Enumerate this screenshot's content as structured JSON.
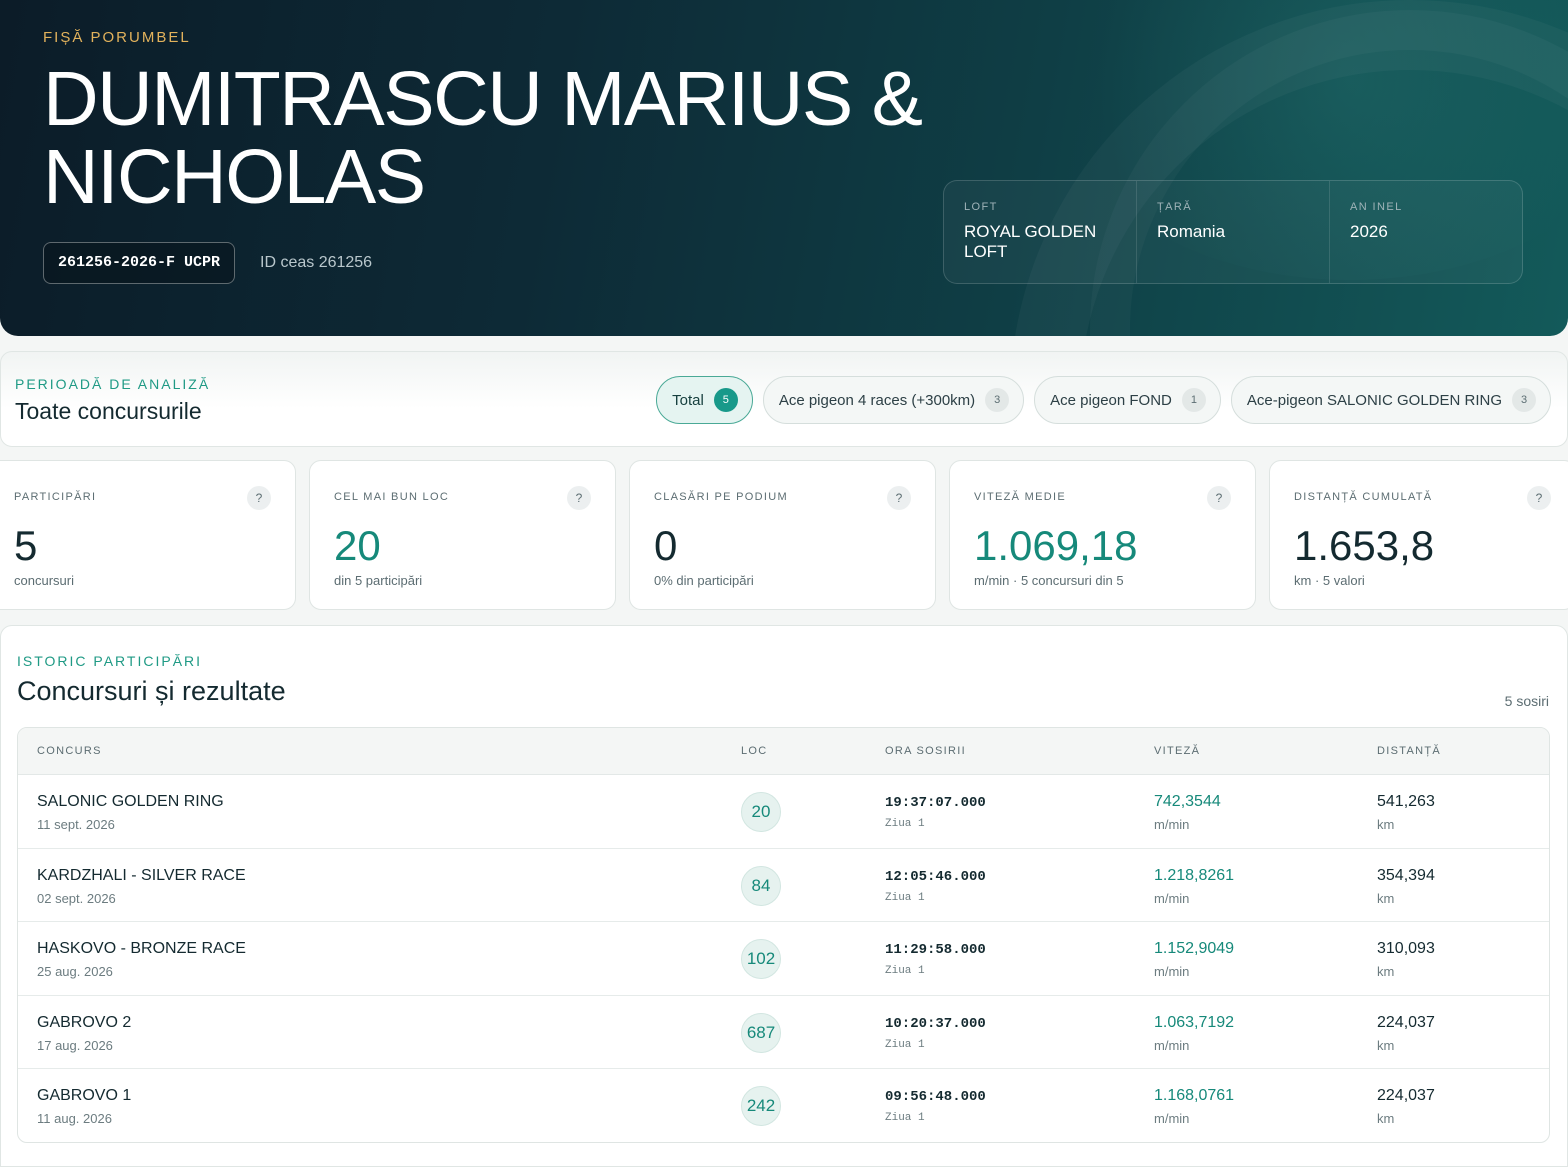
{
  "hero": {
    "eyebrow": "FIȘĂ PORUMBEL",
    "name": "DUMITRASCU MARIUS & NICHOLAS",
    "ring": "261256-2026-F UCPR",
    "clock_id": "ID ceas 261256",
    "info": [
      {
        "label": "LOFT",
        "value": "ROYAL GOLDEN LOFT"
      },
      {
        "label": "ȚARĂ",
        "value": "Romania"
      },
      {
        "label": "AN INEL",
        "value": "2026"
      }
    ]
  },
  "period": {
    "eyebrow": "PERIOADĂ DE ANALIZĂ",
    "title": "Toate concursurile",
    "chips": [
      {
        "label": "Total",
        "count": "5",
        "active": true
      },
      {
        "label": "Ace pigeon 4 races (+300km)",
        "count": "3",
        "active": false
      },
      {
        "label": "Ace pigeon FOND",
        "count": "1",
        "active": false
      },
      {
        "label": "Ace-pigeon SALONIC GOLDEN RING",
        "count": "3",
        "active": false
      }
    ]
  },
  "stats": [
    {
      "label": "PARTICIPĂRI",
      "value": "5",
      "sub": "concursuri",
      "accent": false
    },
    {
      "label": "CEL MAI BUN LOC",
      "value": "20",
      "sub": "din 5 participări",
      "accent": true
    },
    {
      "label": "CLASĂRI PE PODIUM",
      "value": "0",
      "sub": "0% din participări",
      "accent": false
    },
    {
      "label": "VITEZĂ MEDIE",
      "value": "1.069,18",
      "sub": "m/min · 5 concursuri din 5",
      "accent": true
    },
    {
      "label": "DISTANȚĂ CUMULATĂ",
      "value": "1.653,8",
      "sub": "km · 5 valori",
      "accent": false
    }
  ],
  "help_glyph": "?",
  "history": {
    "eyebrow": "ISTORIC PARTICIPĂRI",
    "title": "Concursuri și rezultate",
    "count": "5 sosiri",
    "columns": {
      "race": "CONCURS",
      "place": "LOC",
      "arrival": "ORA SOSIRII",
      "speed": "VITEZĂ",
      "distance": "DISTANȚĂ"
    },
    "rows": [
      {
        "race": "SALONIC GOLDEN RING",
        "date": "11 sept. 2026",
        "place": "20",
        "time": "19:37:07.000",
        "day": "Ziua 1",
        "speed": "742,3544",
        "speed_unit": "m/min",
        "distance": "541,263",
        "distance_unit": "km"
      },
      {
        "race": "KARDZHALI - SILVER RACE",
        "date": "02 sept. 2026",
        "place": "84",
        "time": "12:05:46.000",
        "day": "Ziua 1",
        "speed": "1.218,8261",
        "speed_unit": "m/min",
        "distance": "354,394",
        "distance_unit": "km"
      },
      {
        "race": "HASKOVO - BRONZE RACE",
        "date": "25 aug. 2026",
        "place": "102",
        "time": "11:29:58.000",
        "day": "Ziua 1",
        "speed": "1.152,9049",
        "speed_unit": "m/min",
        "distance": "310,093",
        "distance_unit": "km"
      },
      {
        "race": "GABROVO 2",
        "date": "17 aug. 2026",
        "place": "687",
        "time": "10:20:37.000",
        "day": "Ziua 1",
        "speed": "1.063,7192",
        "speed_unit": "m/min",
        "distance": "224,037",
        "distance_unit": "km"
      },
      {
        "race": "GABROVO 1",
        "date": "11 aug. 2026",
        "place": "242",
        "time": "09:56:48.000",
        "day": "Ziua 1",
        "speed": "1.168,0761",
        "speed_unit": "m/min",
        "distance": "224,037",
        "distance_unit": "km"
      }
    ]
  }
}
